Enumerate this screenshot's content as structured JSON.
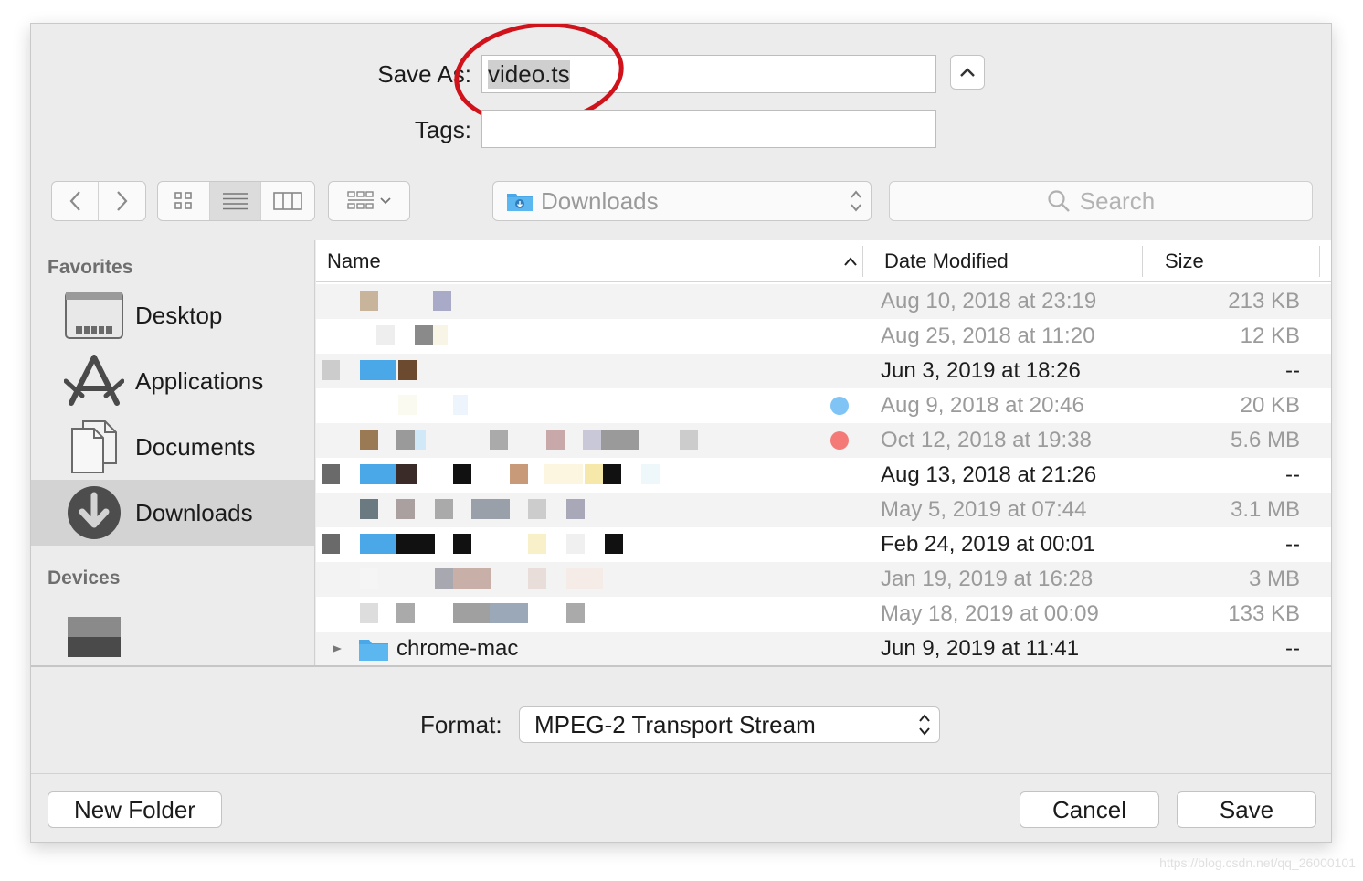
{
  "form": {
    "save_as_label": "Save As:",
    "filename_value": "video.ts",
    "tags_label": "Tags:",
    "tags_value": ""
  },
  "toolbar": {
    "location": "Downloads",
    "search_placeholder": "Search"
  },
  "sidebar": {
    "favorites_heading": "Favorites",
    "devices_heading": "Devices",
    "items": [
      {
        "label": "Desktop"
      },
      {
        "label": "Applications"
      },
      {
        "label": "Documents"
      },
      {
        "label": "Downloads",
        "selected": true
      }
    ]
  },
  "list": {
    "columns": {
      "name": "Name",
      "date": "Date Modified",
      "size": "Size"
    },
    "sort_indicator": "ascending",
    "rows": [
      {
        "date": "Aug 10, 2018 at 23:19",
        "size": "213 KB",
        "dim": true
      },
      {
        "date": "Aug 25, 2018 at 11:20",
        "size": "12 KB",
        "dim": true
      },
      {
        "date": "Jun 3, 2019 at 18:26",
        "size": "--",
        "dim": false
      },
      {
        "date": "Aug 9, 2018 at 20:46",
        "size": "20 KB",
        "dim": true,
        "tag_color": "#7fc4f5"
      },
      {
        "date": "Oct 12, 2018 at 19:38",
        "size": "5.6 MB",
        "dim": true,
        "tag_color": "#f37a76"
      },
      {
        "date": "Aug 13, 2018 at 21:26",
        "size": "--",
        "dim": false
      },
      {
        "date": "May 5, 2019 at 07:44",
        "size": "3.1 MB",
        "dim": true
      },
      {
        "date": "Feb 24, 2019 at 00:01",
        "size": "--",
        "dim": false
      },
      {
        "date": "Jan 19, 2019 at 16:28",
        "size": "3 MB",
        "dim": true
      },
      {
        "date": "May 18, 2019 at 00:09",
        "size": "133 KB",
        "dim": true
      },
      {
        "name": "chrome-mac",
        "date": "Jun 9, 2019 at 11:41",
        "size": "--",
        "dim": false
      }
    ]
  },
  "bottom": {
    "format_label": "Format:",
    "format_value": "MPEG-2 Transport Stream",
    "new_folder_label": "New Folder",
    "cancel_label": "Cancel",
    "save_label": "Save"
  },
  "watermark": "https://blog.csdn.net/qq_26000101",
  "colors": {
    "annotation_circle": "#d0121b",
    "folder_blue": "#4aa8e8",
    "tag_blue": "#7fc4f5",
    "tag_red": "#f37a76"
  }
}
